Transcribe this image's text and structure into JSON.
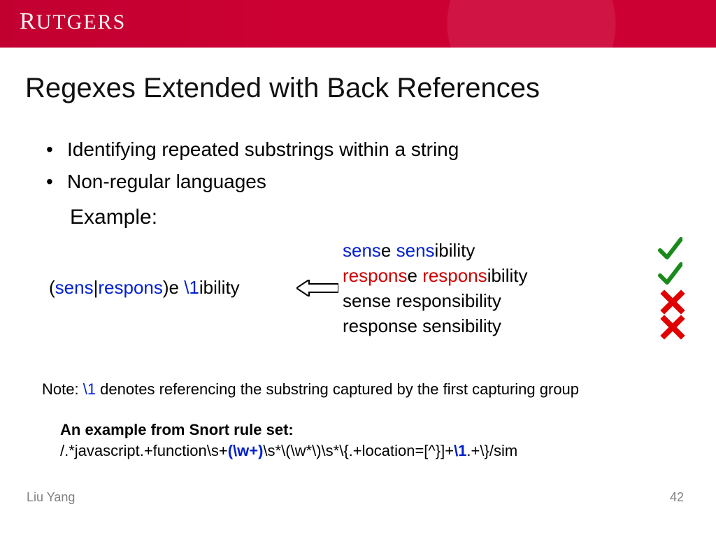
{
  "header": {
    "logo_main": "R",
    "logo_rest": "UTGERS"
  },
  "title": "Regexes Extended with Back References",
  "bullets": [
    "Identifying repeated substrings within a string",
    "Non-regular languages"
  ],
  "example_label": "Example:",
  "regex": {
    "open": "(",
    "alt1": "sens",
    "pipe": "|",
    "alt2": "respons",
    "close": ")e ",
    "backref": "\\1",
    "tail": "ibility"
  },
  "matches": [
    {
      "p1": "sens",
      "p2": "e ",
      "p3": "sens",
      "p4": "ibility",
      "colored": true
    },
    {
      "p1": "respons",
      "p2": "e ",
      "p3": "respons",
      "p4": "ibility",
      "colored": true
    },
    {
      "text": "sense responsibility"
    },
    {
      "text": "response sensibility"
    }
  ],
  "note": {
    "prefix": "Note: ",
    "ref": "\\1",
    "suffix": " denotes referencing the substring captured by the first capturing group"
  },
  "snort": {
    "heading": "An example from Snort rule set:",
    "s1": "/.*javascript.+function\\s+",
    "hl1": "(\\w+)",
    "s2": "\\s*\\(\\w*\\)\\s*\\{.+location=[^}]+",
    "hl2": "\\1",
    "s3": ".+\\}/sim"
  },
  "footer": {
    "author": "Liu Yang",
    "page": "42"
  }
}
